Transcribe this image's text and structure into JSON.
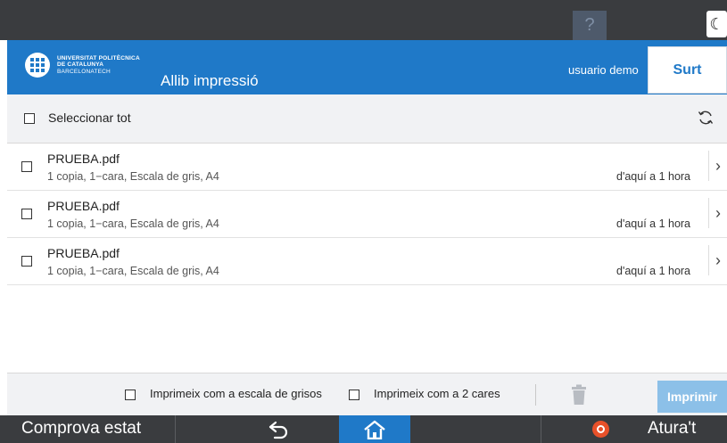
{
  "topbar": {
    "help_symbol": "?",
    "help_icon": "question-icon",
    "moon_icon": "moon-icon"
  },
  "header": {
    "logo_lines": [
      "UNIVERSITAT POLITÈCNICA",
      "DE CATALUNYA",
      "BARCELONATECH"
    ],
    "logo_badge": "UPC",
    "app_title": "Allib impressió",
    "user": "usuario demo",
    "logout_label": "Surt",
    "accent_color": "#1f79c8"
  },
  "select_all": {
    "label": "Seleccionar tot",
    "checked": false,
    "refresh_icon": "refresh-icon"
  },
  "jobs": [
    {
      "name": "PRUEBA.pdf",
      "details": "1 copia, 1−cara, Escala de gris, A4",
      "time": "d'aquí a 1 hora",
      "checked": false
    },
    {
      "name": "PRUEBA.pdf",
      "details": "1 copia, 1−cara, Escala de gris, A4",
      "time": "d'aquí a 1 hora",
      "checked": false
    },
    {
      "name": "PRUEBA.pdf",
      "details": "1 copia, 1−cara, Escala de gris, A4",
      "time": "d'aquí a 1 hora",
      "checked": false
    }
  ],
  "options": {
    "grayscale_label": "Imprimeix com a escala de grisos",
    "grayscale_checked": false,
    "duplex_label": "Imprimeix com a 2 cares",
    "duplex_checked": false,
    "delete_icon": "trash-icon",
    "print_label": "Imprimir",
    "print_color": "#8cc0e8"
  },
  "footer": {
    "status_label": "Comprova estat",
    "back_icon": "back-arrow-icon",
    "home_icon": "home-icon",
    "stop_icon": "stop-icon",
    "stop_label": "Atura't"
  }
}
